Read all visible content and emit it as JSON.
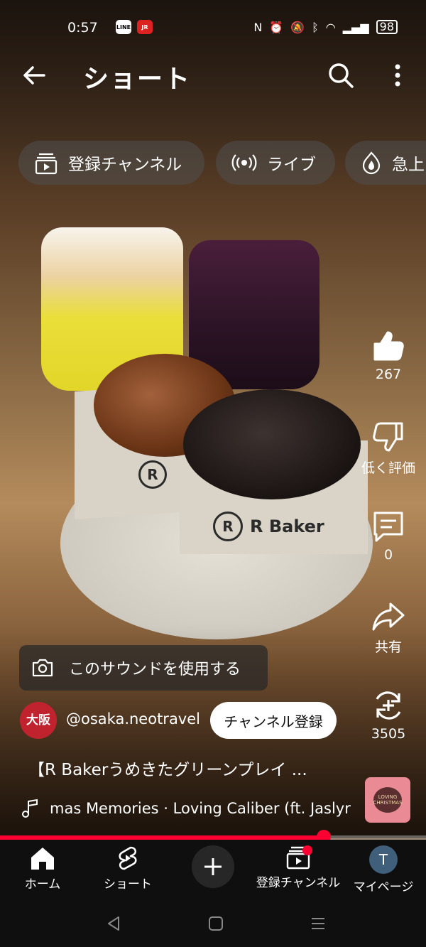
{
  "status_bar": {
    "time": "0:57",
    "battery": "98",
    "app_icons": [
      "LINE",
      "JR"
    ]
  },
  "header": {
    "title": "ショート"
  },
  "chips": [
    {
      "label": "登録チャンネル",
      "icon": "subscriptions-icon"
    },
    {
      "label": "ライブ",
      "icon": "live-icon"
    },
    {
      "label": "急上",
      "icon": "trending-icon"
    }
  ],
  "photo": {
    "brand_text": "R Baker"
  },
  "actions": {
    "like_count": "267",
    "dislike_label": "低く評価",
    "comment_count": "0",
    "share_label": "共有",
    "remix_count": "3505"
  },
  "sound_button": {
    "label": "このサウンドを使用する"
  },
  "channel": {
    "avatar_text": "大阪",
    "handle": "@osaka.neotravel",
    "subscribe_label": "チャンネル登録"
  },
  "video": {
    "description": "【R Bakerうめきたグリーンプレイ ...",
    "music": "mas Memories · Loving Caliber (ft. Jaslyr",
    "thumb_text": "LOVING CHRISTMAS",
    "progress": 0.76
  },
  "nav": {
    "home": "ホーム",
    "shorts": "ショート",
    "subscriptions": "登録チャンネル",
    "mypage": "マイページ",
    "avatar_letter": "T"
  }
}
